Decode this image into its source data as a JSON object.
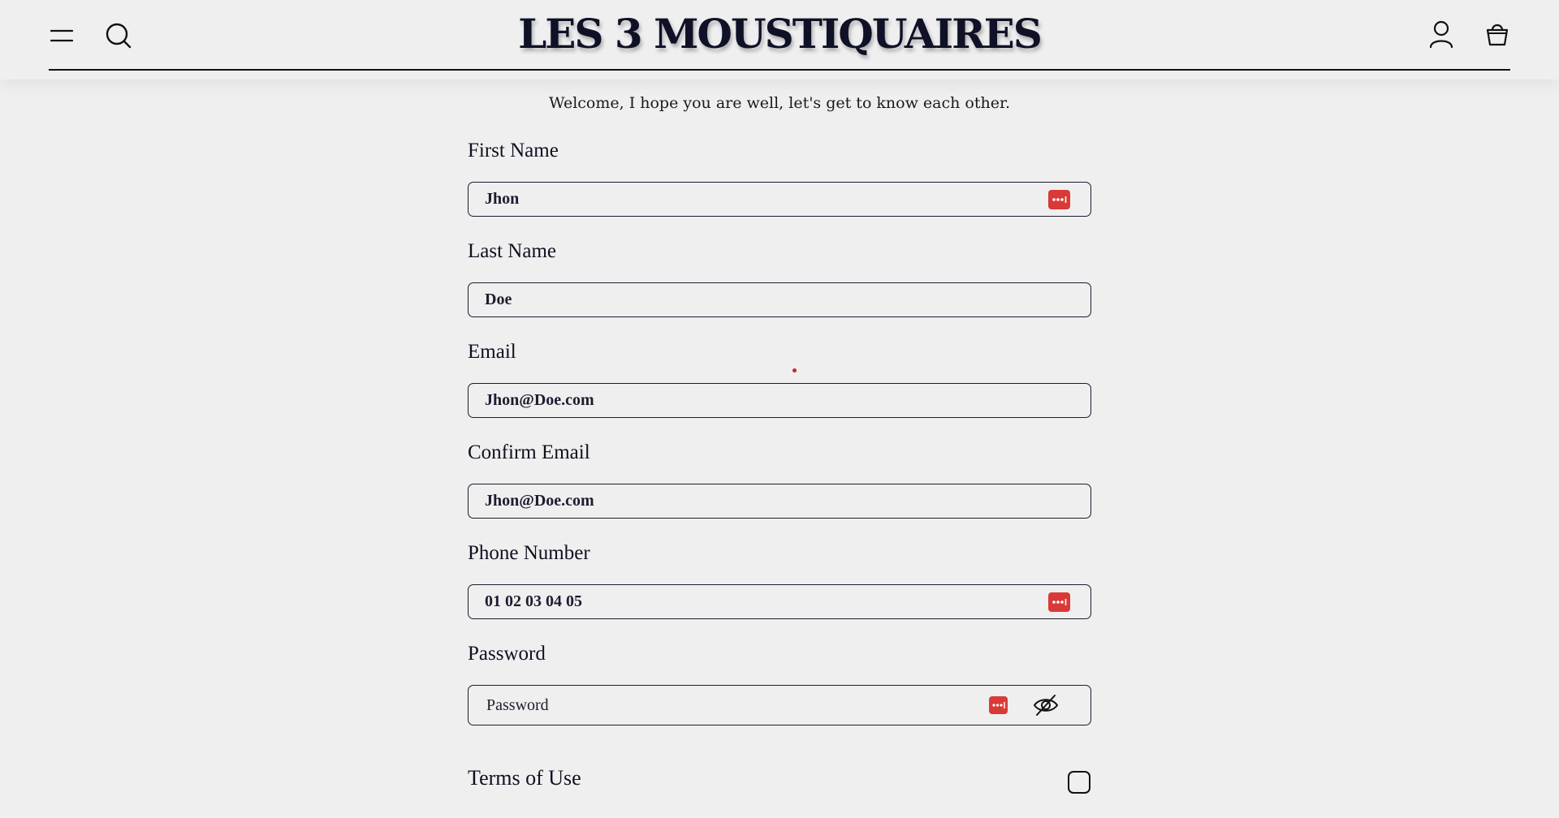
{
  "header": {
    "brand": "LES 3 MOUSTIQUAIRES",
    "icons": [
      "menu-icon",
      "search-icon",
      "user-icon",
      "basket-icon"
    ]
  },
  "welcome": "Welcome, I hope you are well, let's get to know each other.",
  "fields": {
    "first_name": {
      "label": "First Name",
      "value": "Jhon"
    },
    "last_name": {
      "label": "Last Name",
      "value": "Doe"
    },
    "email": {
      "label": "Email",
      "value": "Jhon@Doe.com"
    },
    "confirm_email": {
      "label": "Confirm Email",
      "value": "Jhon@Doe.com"
    },
    "phone": {
      "label": "Phone Number",
      "value": "01 02 03 04 05"
    },
    "password": {
      "label": "Password",
      "placeholder": "Password"
    }
  },
  "terms": {
    "label": "Terms of Use"
  },
  "colors": {
    "autofill": "#d93a37",
    "text": "#0f1020",
    "background": "#efeff0"
  }
}
